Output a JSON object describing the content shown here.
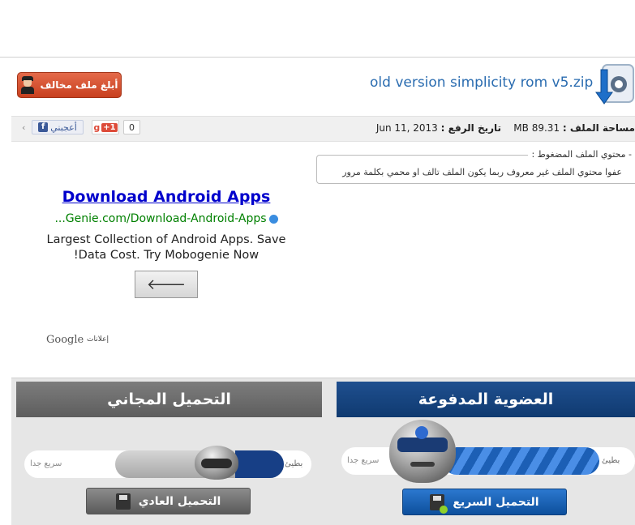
{
  "report_button": {
    "label": "أبلغ ملف مخالف"
  },
  "file": {
    "title": "old version simplicity rom v5.zip",
    "size_label": "مساحة الملف :",
    "size_value": "89.31 MB",
    "date_label": "تاريخ الرفع :",
    "date_value": "Jun 11, 2013"
  },
  "social": {
    "like_label": "أعجبني",
    "gplus_label": "+1",
    "count": "0"
  },
  "compressed": {
    "legend": "- محتوي الملف المضغوط :",
    "message": "عفوا محتوي الملف غير معروف ربما يكون الملف تالف او محمي بكلمة مرور"
  },
  "ad": {
    "title": "Download Android Apps",
    "url": "Genie.com/Download-Android-Apps...",
    "desc_line1": "Largest Collection of Android Apps. Save",
    "desc_line2": "Data Cost. Try Mobogenie Now!",
    "google": "Google",
    "ads_label": "إعلانات"
  },
  "download": {
    "free_header": "التحميل المجاني",
    "paid_header": "العضوية المدفوعة",
    "slow_label": "بطيئ",
    "fast_label": "سريع جدا",
    "free_button": "التحميل العادي",
    "paid_button": "التحميل السريع"
  },
  "colors": {
    "accent_blue": "#2a6cb0",
    "report_red": "#d24f2c",
    "paid_blue": "#0f3a70",
    "free_gray": "#6d6d6d"
  }
}
